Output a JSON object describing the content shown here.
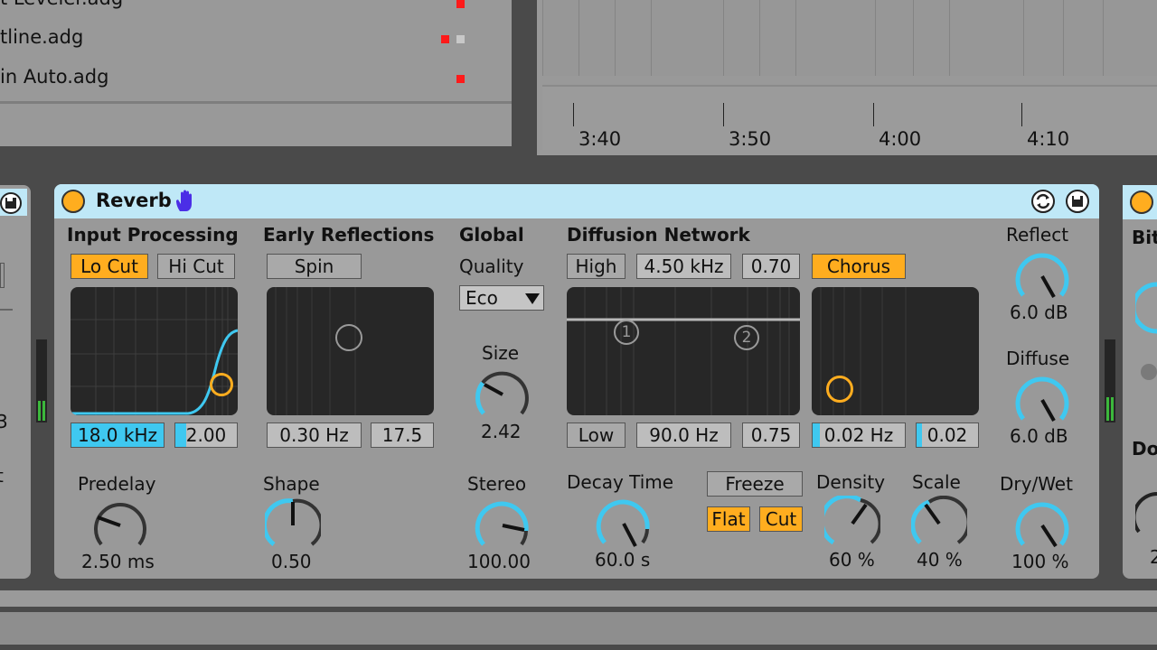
{
  "browser": {
    "items": [
      {
        "label": "t Leveler.adg"
      },
      {
        "label": "tline.adg"
      },
      {
        "label": "in Auto.adg"
      }
    ]
  },
  "timeline": {
    "markers": [
      "3:40",
      "3:50",
      "4:00",
      "4:10"
    ]
  },
  "right_device": {
    "partial_labels": [
      "Bit",
      "Do",
      "2"
    ]
  },
  "left_device": {
    "partial_labels": [
      "3",
      "t"
    ]
  },
  "device": {
    "title": "Reverb",
    "icons": [
      "hand-icon",
      "hot-swap-icon",
      "save-icon"
    ],
    "accent_color": "#3fc8f0",
    "on_color": "#ffad1f",
    "input_processing": {
      "heading": "Input Processing",
      "lo_cut": {
        "label": "Lo Cut",
        "on": true
      },
      "hi_cut": {
        "label": "Hi Cut",
        "on": false
      },
      "freq": "18.0 kHz",
      "q": "2.00"
    },
    "early_reflections": {
      "heading": "Early Reflections",
      "spin": {
        "label": "Spin",
        "on": false
      },
      "rate": "0.30 Hz",
      "amount": "17.5"
    },
    "global": {
      "heading": "Global",
      "quality_label": "Quality",
      "quality_value": "Eco",
      "size_label": "Size",
      "size_value": "2.42",
      "stereo_label": "Stereo",
      "stereo_value": "100.00"
    },
    "diffusion_network": {
      "heading": "Diffusion Network",
      "high": {
        "label": "High",
        "on": false
      },
      "high_freq": "4.50 kHz",
      "high_amount": "0.70",
      "low": {
        "label": "Low",
        "on": false
      },
      "low_freq": "90.0 Hz",
      "low_amount": "0.75",
      "chorus": {
        "label": "Chorus",
        "on": true
      },
      "chorus_rate": "0.02 Hz",
      "chorus_amount": "0.02",
      "handle1": "1",
      "handle2": "2"
    },
    "knobs": {
      "predelay": {
        "label": "Predelay",
        "value": "2.50 ms"
      },
      "shape": {
        "label": "Shape",
        "value": "0.50"
      },
      "decay": {
        "label": "Decay Time",
        "value": "60.0 s"
      },
      "density": {
        "label": "Density",
        "value": "60 %"
      },
      "scale": {
        "label": "Scale",
        "value": "40 %"
      },
      "reflect": {
        "label": "Reflect",
        "value": "6.0 dB"
      },
      "diffuse": {
        "label": "Diffuse",
        "value": "6.0 dB"
      },
      "drywet": {
        "label": "Dry/Wet",
        "value": "100 %"
      }
    },
    "freeze": {
      "label": "Freeze",
      "on": false
    },
    "flat": {
      "label": "Flat",
      "on": true
    },
    "cut": {
      "label": "Cut",
      "on": true
    }
  }
}
